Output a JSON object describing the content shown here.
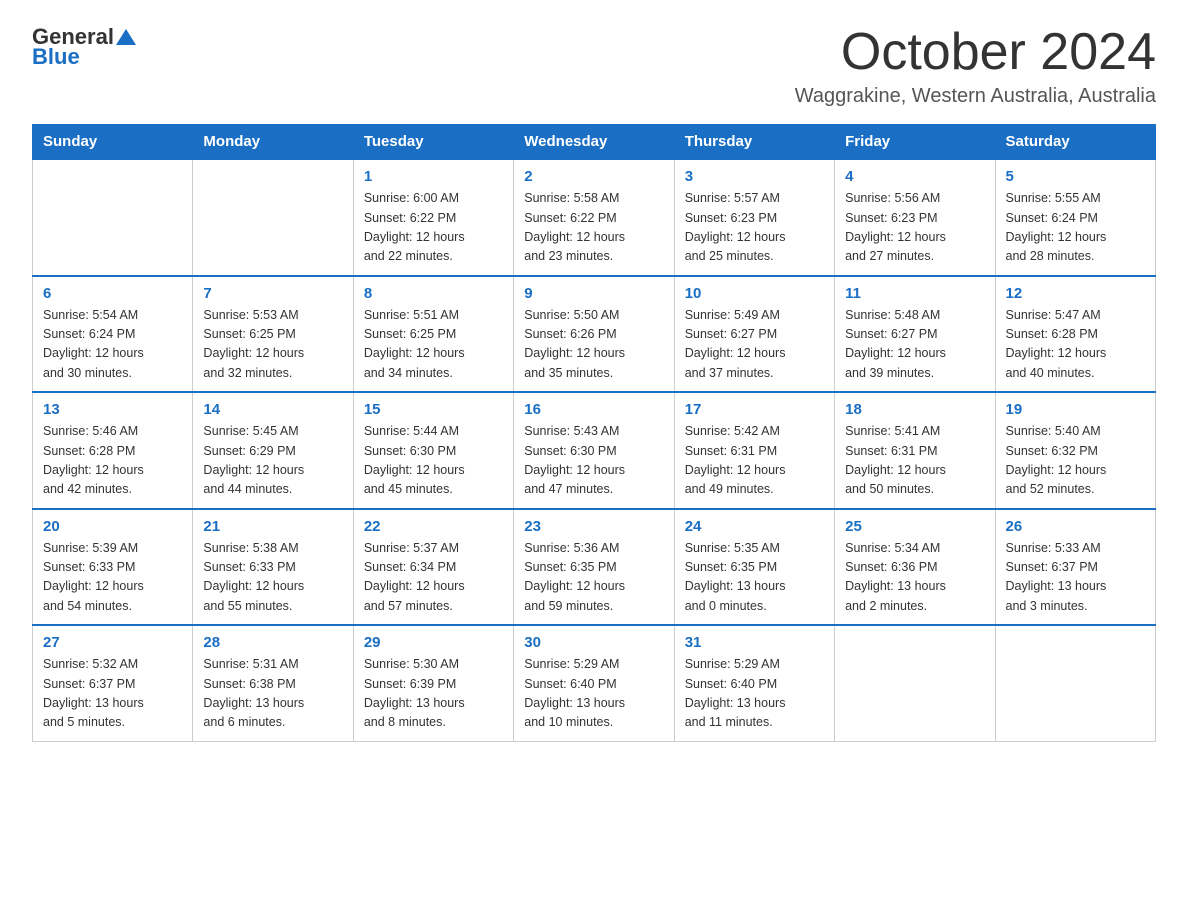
{
  "logo": {
    "general": "General",
    "blue": "Blue"
  },
  "title": "October 2024",
  "location": "Waggrakine, Western Australia, Australia",
  "days_of_week": [
    "Sunday",
    "Monday",
    "Tuesday",
    "Wednesday",
    "Thursday",
    "Friday",
    "Saturday"
  ],
  "weeks": [
    [
      {
        "day": "",
        "info": ""
      },
      {
        "day": "",
        "info": ""
      },
      {
        "day": "1",
        "info": "Sunrise: 6:00 AM\nSunset: 6:22 PM\nDaylight: 12 hours\nand 22 minutes."
      },
      {
        "day": "2",
        "info": "Sunrise: 5:58 AM\nSunset: 6:22 PM\nDaylight: 12 hours\nand 23 minutes."
      },
      {
        "day": "3",
        "info": "Sunrise: 5:57 AM\nSunset: 6:23 PM\nDaylight: 12 hours\nand 25 minutes."
      },
      {
        "day": "4",
        "info": "Sunrise: 5:56 AM\nSunset: 6:23 PM\nDaylight: 12 hours\nand 27 minutes."
      },
      {
        "day": "5",
        "info": "Sunrise: 5:55 AM\nSunset: 6:24 PM\nDaylight: 12 hours\nand 28 minutes."
      }
    ],
    [
      {
        "day": "6",
        "info": "Sunrise: 5:54 AM\nSunset: 6:24 PM\nDaylight: 12 hours\nand 30 minutes."
      },
      {
        "day": "7",
        "info": "Sunrise: 5:53 AM\nSunset: 6:25 PM\nDaylight: 12 hours\nand 32 minutes."
      },
      {
        "day": "8",
        "info": "Sunrise: 5:51 AM\nSunset: 6:25 PM\nDaylight: 12 hours\nand 34 minutes."
      },
      {
        "day": "9",
        "info": "Sunrise: 5:50 AM\nSunset: 6:26 PM\nDaylight: 12 hours\nand 35 minutes."
      },
      {
        "day": "10",
        "info": "Sunrise: 5:49 AM\nSunset: 6:27 PM\nDaylight: 12 hours\nand 37 minutes."
      },
      {
        "day": "11",
        "info": "Sunrise: 5:48 AM\nSunset: 6:27 PM\nDaylight: 12 hours\nand 39 minutes."
      },
      {
        "day": "12",
        "info": "Sunrise: 5:47 AM\nSunset: 6:28 PM\nDaylight: 12 hours\nand 40 minutes."
      }
    ],
    [
      {
        "day": "13",
        "info": "Sunrise: 5:46 AM\nSunset: 6:28 PM\nDaylight: 12 hours\nand 42 minutes."
      },
      {
        "day": "14",
        "info": "Sunrise: 5:45 AM\nSunset: 6:29 PM\nDaylight: 12 hours\nand 44 minutes."
      },
      {
        "day": "15",
        "info": "Sunrise: 5:44 AM\nSunset: 6:30 PM\nDaylight: 12 hours\nand 45 minutes."
      },
      {
        "day": "16",
        "info": "Sunrise: 5:43 AM\nSunset: 6:30 PM\nDaylight: 12 hours\nand 47 minutes."
      },
      {
        "day": "17",
        "info": "Sunrise: 5:42 AM\nSunset: 6:31 PM\nDaylight: 12 hours\nand 49 minutes."
      },
      {
        "day": "18",
        "info": "Sunrise: 5:41 AM\nSunset: 6:31 PM\nDaylight: 12 hours\nand 50 minutes."
      },
      {
        "day": "19",
        "info": "Sunrise: 5:40 AM\nSunset: 6:32 PM\nDaylight: 12 hours\nand 52 minutes."
      }
    ],
    [
      {
        "day": "20",
        "info": "Sunrise: 5:39 AM\nSunset: 6:33 PM\nDaylight: 12 hours\nand 54 minutes."
      },
      {
        "day": "21",
        "info": "Sunrise: 5:38 AM\nSunset: 6:33 PM\nDaylight: 12 hours\nand 55 minutes."
      },
      {
        "day": "22",
        "info": "Sunrise: 5:37 AM\nSunset: 6:34 PM\nDaylight: 12 hours\nand 57 minutes."
      },
      {
        "day": "23",
        "info": "Sunrise: 5:36 AM\nSunset: 6:35 PM\nDaylight: 12 hours\nand 59 minutes."
      },
      {
        "day": "24",
        "info": "Sunrise: 5:35 AM\nSunset: 6:35 PM\nDaylight: 13 hours\nand 0 minutes."
      },
      {
        "day": "25",
        "info": "Sunrise: 5:34 AM\nSunset: 6:36 PM\nDaylight: 13 hours\nand 2 minutes."
      },
      {
        "day": "26",
        "info": "Sunrise: 5:33 AM\nSunset: 6:37 PM\nDaylight: 13 hours\nand 3 minutes."
      }
    ],
    [
      {
        "day": "27",
        "info": "Sunrise: 5:32 AM\nSunset: 6:37 PM\nDaylight: 13 hours\nand 5 minutes."
      },
      {
        "day": "28",
        "info": "Sunrise: 5:31 AM\nSunset: 6:38 PM\nDaylight: 13 hours\nand 6 minutes."
      },
      {
        "day": "29",
        "info": "Sunrise: 5:30 AM\nSunset: 6:39 PM\nDaylight: 13 hours\nand 8 minutes."
      },
      {
        "day": "30",
        "info": "Sunrise: 5:29 AM\nSunset: 6:40 PM\nDaylight: 13 hours\nand 10 minutes."
      },
      {
        "day": "31",
        "info": "Sunrise: 5:29 AM\nSunset: 6:40 PM\nDaylight: 13 hours\nand 11 minutes."
      },
      {
        "day": "",
        "info": ""
      },
      {
        "day": "",
        "info": ""
      }
    ]
  ]
}
